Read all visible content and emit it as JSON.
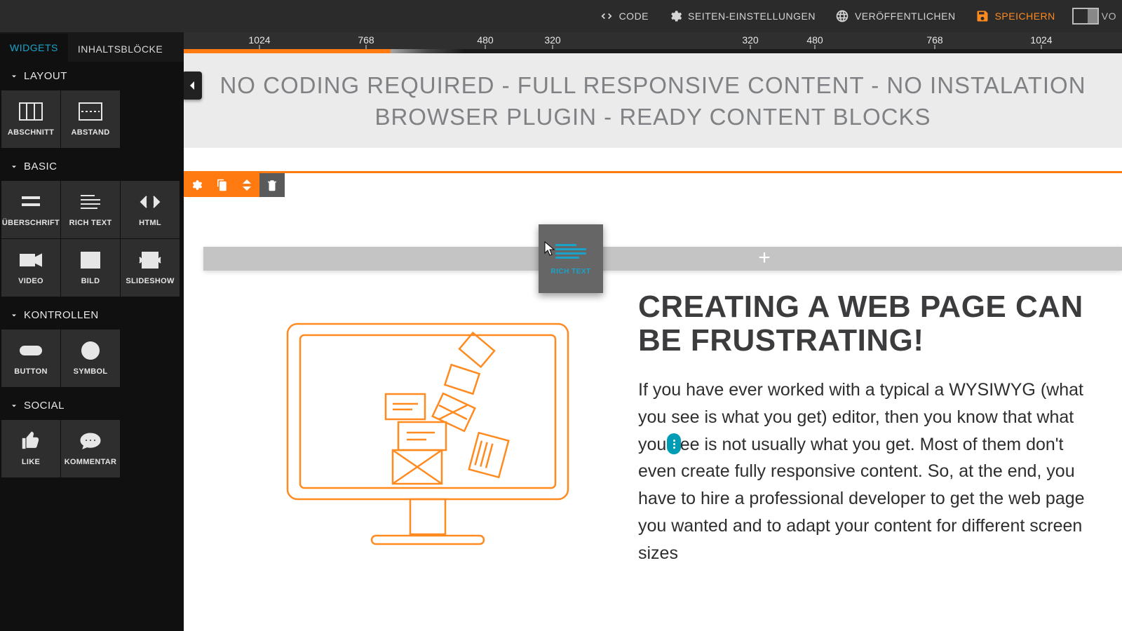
{
  "topbar": {
    "code": "CODE",
    "settings": "SEITEN-EINSTELLUNGEN",
    "publish": "VERÖFFENTLICHEN",
    "save": "SPEICHERN",
    "trailing": "VO"
  },
  "ruler": {
    "ticks": [
      "1024",
      "768",
      "480",
      "320",
      "320",
      "480",
      "768",
      "1024"
    ]
  },
  "tabs": {
    "widgets": "WIDGETS",
    "blocks": "INHALTSBLÖCKE"
  },
  "sidebar": {
    "layout": {
      "title": "LAYOUT",
      "items": [
        {
          "label": "ABSCHNITT"
        },
        {
          "label": "ABSTAND"
        }
      ]
    },
    "basic": {
      "title": "BASIC",
      "items": [
        {
          "label": "ÜBERSCHRIFT"
        },
        {
          "label": "RICH TEXT"
        },
        {
          "label": "HTML"
        },
        {
          "label": "VIDEO"
        },
        {
          "label": "BILD"
        },
        {
          "label": "SLIDESHOW"
        }
      ]
    },
    "controls": {
      "title": "KONTROLLEN",
      "items": [
        {
          "label": "BUTTON"
        },
        {
          "label": "SYMBOL"
        }
      ]
    },
    "social": {
      "title": "SOCIAL",
      "items": [
        {
          "label": "LIKE"
        },
        {
          "label": "KOMMENTAR"
        }
      ]
    }
  },
  "canvas": {
    "hero_line1": "NO CODING REQUIRED - FULL RESPONSIVE CONTENT - NO INSTALATION",
    "hero_line2": "BROWSER PLUGIN - READY CONTENT BLOCKS",
    "drag_ghost_label": "RICH TEXT",
    "headline": "CREATING A WEB PAGE CAN BE FRUSTRATING!",
    "body": "If you have ever worked with a typical a WYSIWYG (what you see is what you get) editor, then you know that what you see is not usually what you get. Most of them don't even create fully responsive content. So, at the end, you have to hire a professional developer to get the web page you wanted and to adapt your content for different screen sizes"
  },
  "colors": {
    "accent": "#ff7a10",
    "link": "#1aa3c9"
  }
}
